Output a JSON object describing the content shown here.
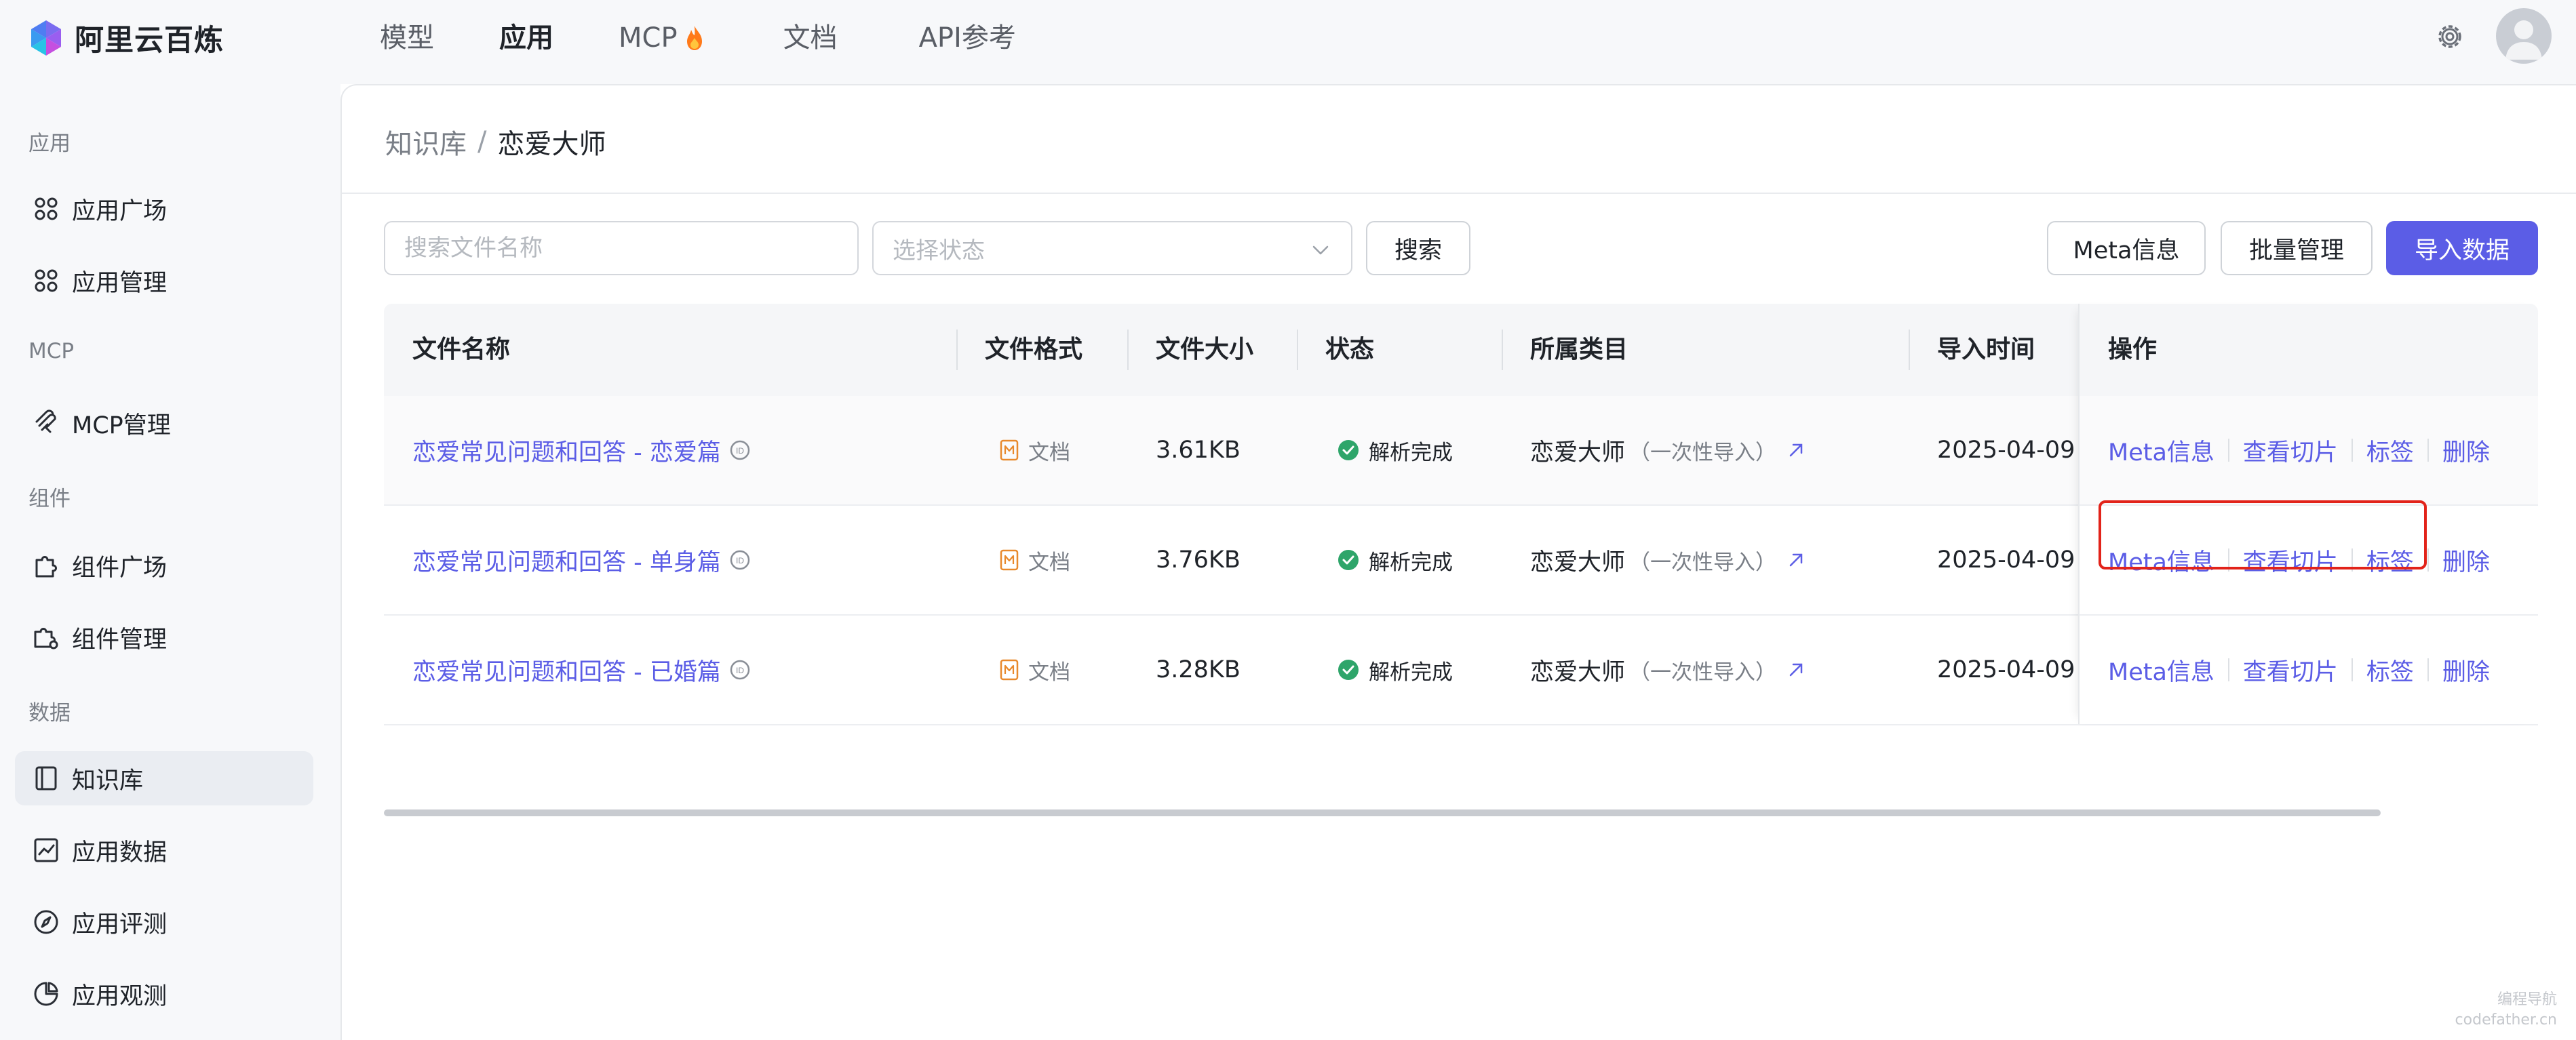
{
  "brand": {
    "name": "阿里云百炼"
  },
  "topnav": {
    "models": "模型",
    "apps": "应用",
    "mcp": "MCP",
    "docs": "文档",
    "api": "API参考"
  },
  "sidebar": {
    "group_apps": "应用",
    "app_square": "应用广场",
    "app_manage": "应用管理",
    "group_mcp": "MCP",
    "mcp_manage": "MCP管理",
    "group_components": "组件",
    "component_square": "组件广场",
    "component_manage": "组件管理",
    "group_data": "数据",
    "knowledge_base": "知识库",
    "app_data": "应用数据",
    "app_eval": "应用评测",
    "app_observe": "应用观测"
  },
  "breadcrumb": {
    "root": "知识库",
    "sep": "/",
    "current": "恋爱大师"
  },
  "toolbar": {
    "search_placeholder": "搜索文件名称",
    "status_placeholder": "选择状态",
    "search_button": "搜索",
    "meta_button": "Meta信息",
    "batch_button": "批量管理",
    "import_button": "导入数据"
  },
  "table": {
    "headers": {
      "name": "文件名称",
      "format": "文件格式",
      "size": "文件大小",
      "status": "状态",
      "category": "所属类目",
      "time": "导入时间",
      "ops": "操作"
    },
    "rows": [
      {
        "name": "恋爱常见问题和回答 - 恋爱篇",
        "format": "文档",
        "size": "3.61KB",
        "status": "解析完成",
        "category": "恋爱大师",
        "category_note": "（一次性导入）",
        "time": "2025-04-09"
      },
      {
        "name": "恋爱常见问题和回答 - 单身篇",
        "format": "文档",
        "size": "3.76KB",
        "status": "解析完成",
        "category": "恋爱大师",
        "category_note": "（一次性导入）",
        "time": "2025-04-09"
      },
      {
        "name": "恋爱常见问题和回答 - 已婚篇",
        "format": "文档",
        "size": "3.28KB",
        "status": "解析完成",
        "category": "恋爱大师",
        "category_note": "（一次性导入）",
        "time": "2025-04-09"
      }
    ],
    "ops": {
      "meta": "Meta信息",
      "chunks": "查看切片",
      "tags": "标签",
      "delete": "删除"
    }
  },
  "watermark": {
    "line1": "编程导航",
    "line2": "codefather.cn"
  },
  "colors": {
    "accent": "#5b5de6",
    "highlight": "#e2231a",
    "status_ok": "#2ea56a",
    "format_icon": "#e8892c"
  }
}
